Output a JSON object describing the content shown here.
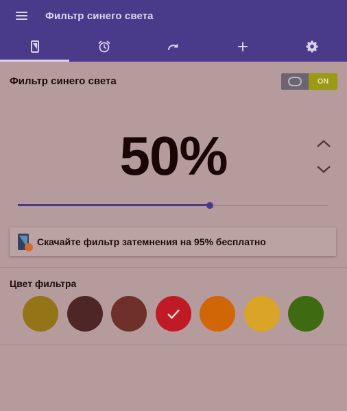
{
  "app": {
    "title": "Фильтр синего света",
    "menu_icon": "hamburger-menu-icon"
  },
  "tabs": [
    {
      "icon": "phone-filter-icon",
      "active": true
    },
    {
      "icon": "alarm-clock-icon",
      "active": false
    },
    {
      "icon": "redo-arrow-icon",
      "active": false
    },
    {
      "icon": "plus-icon",
      "active": false
    },
    {
      "icon": "gear-icon",
      "active": false
    }
  ],
  "filter": {
    "label": "Фильтр синего света",
    "toggle_on_label": "ON",
    "enabled": true
  },
  "intensity": {
    "display": "50%",
    "slider_value": 0.62
  },
  "promo": {
    "text": "Скачайте фильтр затемнения на 95% бесплатно",
    "icon": "dimmer-app-icon"
  },
  "colors": {
    "label": "Цвет фильтра",
    "swatches": [
      {
        "color": "#937417",
        "selected": false
      },
      {
        "color": "#4e2626",
        "selected": false
      },
      {
        "color": "#6e3028",
        "selected": false
      },
      {
        "color": "#c01a26",
        "selected": true
      },
      {
        "color": "#d06606",
        "selected": false
      },
      {
        "color": "#d9a428",
        "selected": false
      },
      {
        "color": "#3e6b12",
        "selected": false
      }
    ]
  },
  "theme": {
    "primary": "#4a3a8a",
    "background": "#b59b9b",
    "toggle_on": "#9a9a15"
  }
}
